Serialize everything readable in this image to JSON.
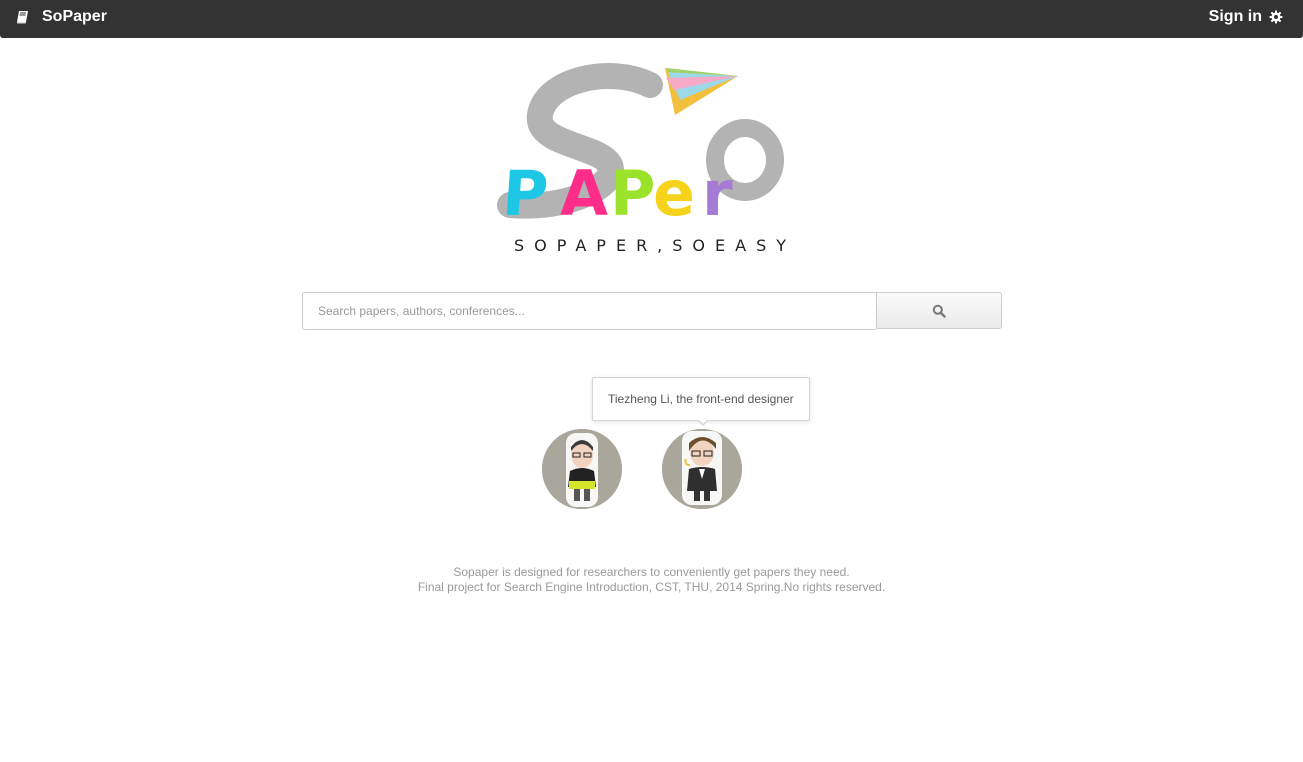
{
  "navbar": {
    "brand_label": "SoPaper",
    "brand_icon": "book-icon",
    "signin_label": "Sign in",
    "signin_icon": "gear-icon",
    "background": "#333333"
  },
  "logo": {
    "tagline": "SOPAPER,SOEASY",
    "letter_colors": [
      "#1fc7e6",
      "#ff2d8a",
      "#9be32a",
      "#f7d21b",
      "#a57bd6"
    ]
  },
  "search": {
    "placeholder": "Search papers, authors, conferences...",
    "value": "",
    "button_icon": "search-icon"
  },
  "team": {
    "tooltip": "Tiezheng Li, the front-end designer",
    "members": [
      {
        "avatar": "avatar"
      },
      {
        "avatar": "avatar"
      }
    ]
  },
  "footer": {
    "line1": "Sopaper is designed for researchers to conveniently get papers they need.",
    "line2": "Final project for Search Engine Introduction, CST, THU, 2014 Spring.No rights reserved."
  }
}
